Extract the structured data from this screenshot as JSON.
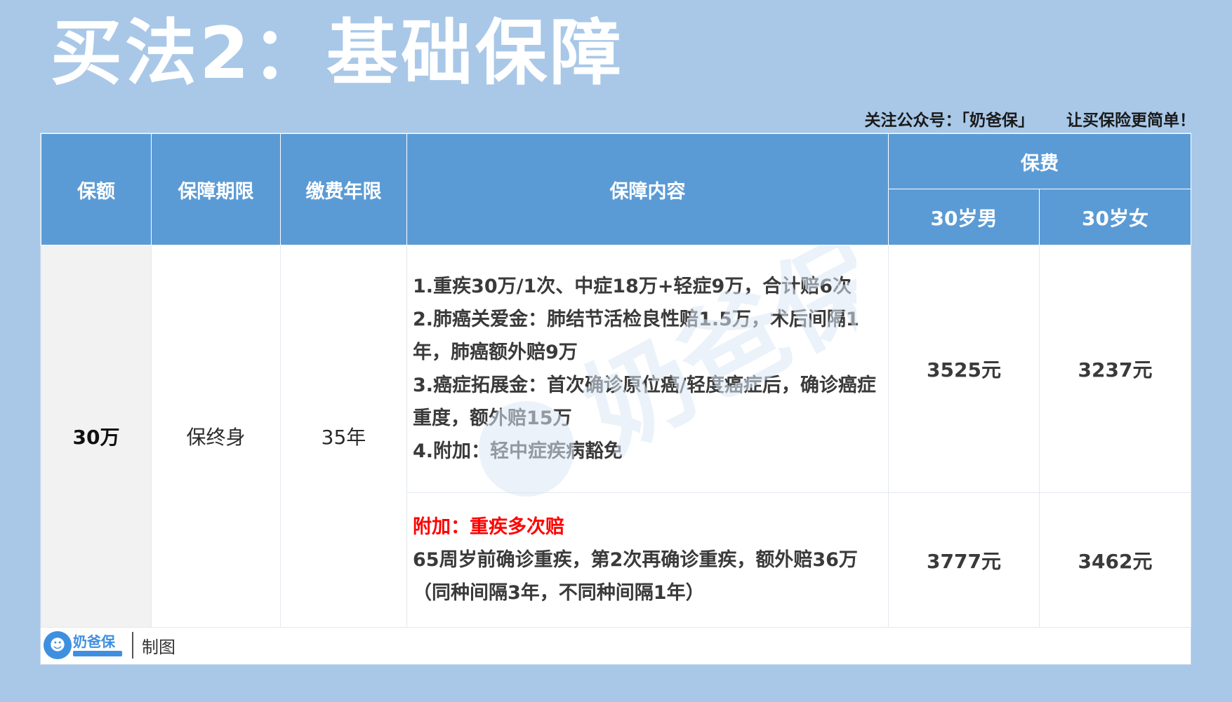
{
  "title": "买法2：基础保障",
  "subline": {
    "follow": "关注公众号：「奶爸保」",
    "slogan": "让买保险更简单！"
  },
  "table": {
    "headers": {
      "amount": "保额",
      "period": "保障期限",
      "payment": "缴费年限",
      "content": "保障内容",
      "premium": "保费",
      "male": "30岁男",
      "female": "30岁女"
    },
    "row": {
      "amount": "30万",
      "period": "保终身",
      "payment": "35年"
    },
    "plans": [
      {
        "lines": [
          "1.重疾30万/1次、中症18万+轻症9万，合计赔6次",
          "2.肺癌关爱金：肺结节活检良性赔1.5万，术后间隔1年，肺癌额外赔9万",
          "3.癌症拓展金：首次确诊原位癌/轻度癌症后，确诊癌症重度，额外赔15万",
          "4.附加：轻中症疾病豁免"
        ],
        "male_price": "3525元",
        "female_price": "3237元"
      },
      {
        "heading": "附加：重疾多次赔",
        "lines": [
          "65周岁前确诊重疾，第2次再确诊重疾，额外赔36万（同种间隔3年，不同种间隔1年）"
        ],
        "male_price": "3777元",
        "female_price": "3462元"
      }
    ]
  },
  "footer": {
    "logo_text": "奶爸保",
    "made": "制图"
  },
  "watermark_text": "奶爸保",
  "colors": {
    "background": "#a9c8e8",
    "header": "#5b9bd5",
    "highlight": "#ff0000"
  }
}
